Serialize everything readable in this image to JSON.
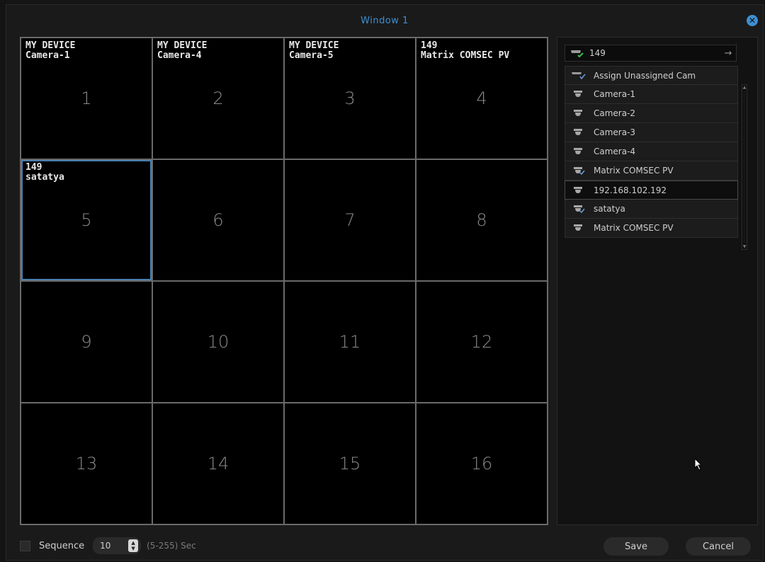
{
  "window": {
    "title": "Window 1"
  },
  "grid": {
    "cells": [
      {
        "num": "1",
        "title": "MY DEVICE\nCamera-1"
      },
      {
        "num": "2",
        "title": "MY DEVICE\nCamera-4"
      },
      {
        "num": "3",
        "title": "MY DEVICE\nCamera-5"
      },
      {
        "num": "4",
        "title": "149\nMatrix COMSEC PV"
      },
      {
        "num": "5",
        "title": "149\nsatatya"
      },
      {
        "num": "6",
        "title": ""
      },
      {
        "num": "7",
        "title": ""
      },
      {
        "num": "8",
        "title": ""
      },
      {
        "num": "9",
        "title": ""
      },
      {
        "num": "10",
        "title": ""
      },
      {
        "num": "11",
        "title": ""
      },
      {
        "num": "12",
        "title": ""
      },
      {
        "num": "13",
        "title": ""
      },
      {
        "num": "14",
        "title": ""
      },
      {
        "num": "15",
        "title": ""
      },
      {
        "num": "16",
        "title": ""
      }
    ],
    "selected_cell": "5"
  },
  "panel": {
    "device": {
      "label": "149",
      "icon": "device-online-icon",
      "go_icon": "arrow-right-icon"
    },
    "cameras": [
      {
        "label": "Assign Unassigned Cam",
        "icon": "multi-camera-icon"
      },
      {
        "label": "Camera-1",
        "icon": "dome-camera-icon"
      },
      {
        "label": "Camera-2",
        "icon": "dome-camera-icon"
      },
      {
        "label": "Camera-3",
        "icon": "dome-camera-icon"
      },
      {
        "label": "Camera-4",
        "icon": "dome-camera-icon"
      },
      {
        "label": "Matrix COMSEC PV",
        "icon": "dome-camera-assigned-icon"
      },
      {
        "label": "192.168.102.192",
        "icon": "dome-camera-icon"
      },
      {
        "label": "satatya",
        "icon": "dome-camera-assigned-icon"
      },
      {
        "label": "Matrix COMSEC PV",
        "icon": "dome-camera-icon"
      }
    ],
    "active_camera_index": 6
  },
  "footer": {
    "sequence_label": "Sequence",
    "sequence_checked": false,
    "interval_value": "10",
    "range_label": "(5-255) Sec",
    "save_label": "Save",
    "cancel_label": "Cancel"
  },
  "colors": {
    "accent": "#3d8fd1",
    "selected_border": "#4a7fb0",
    "cell_bg": "#000000"
  }
}
